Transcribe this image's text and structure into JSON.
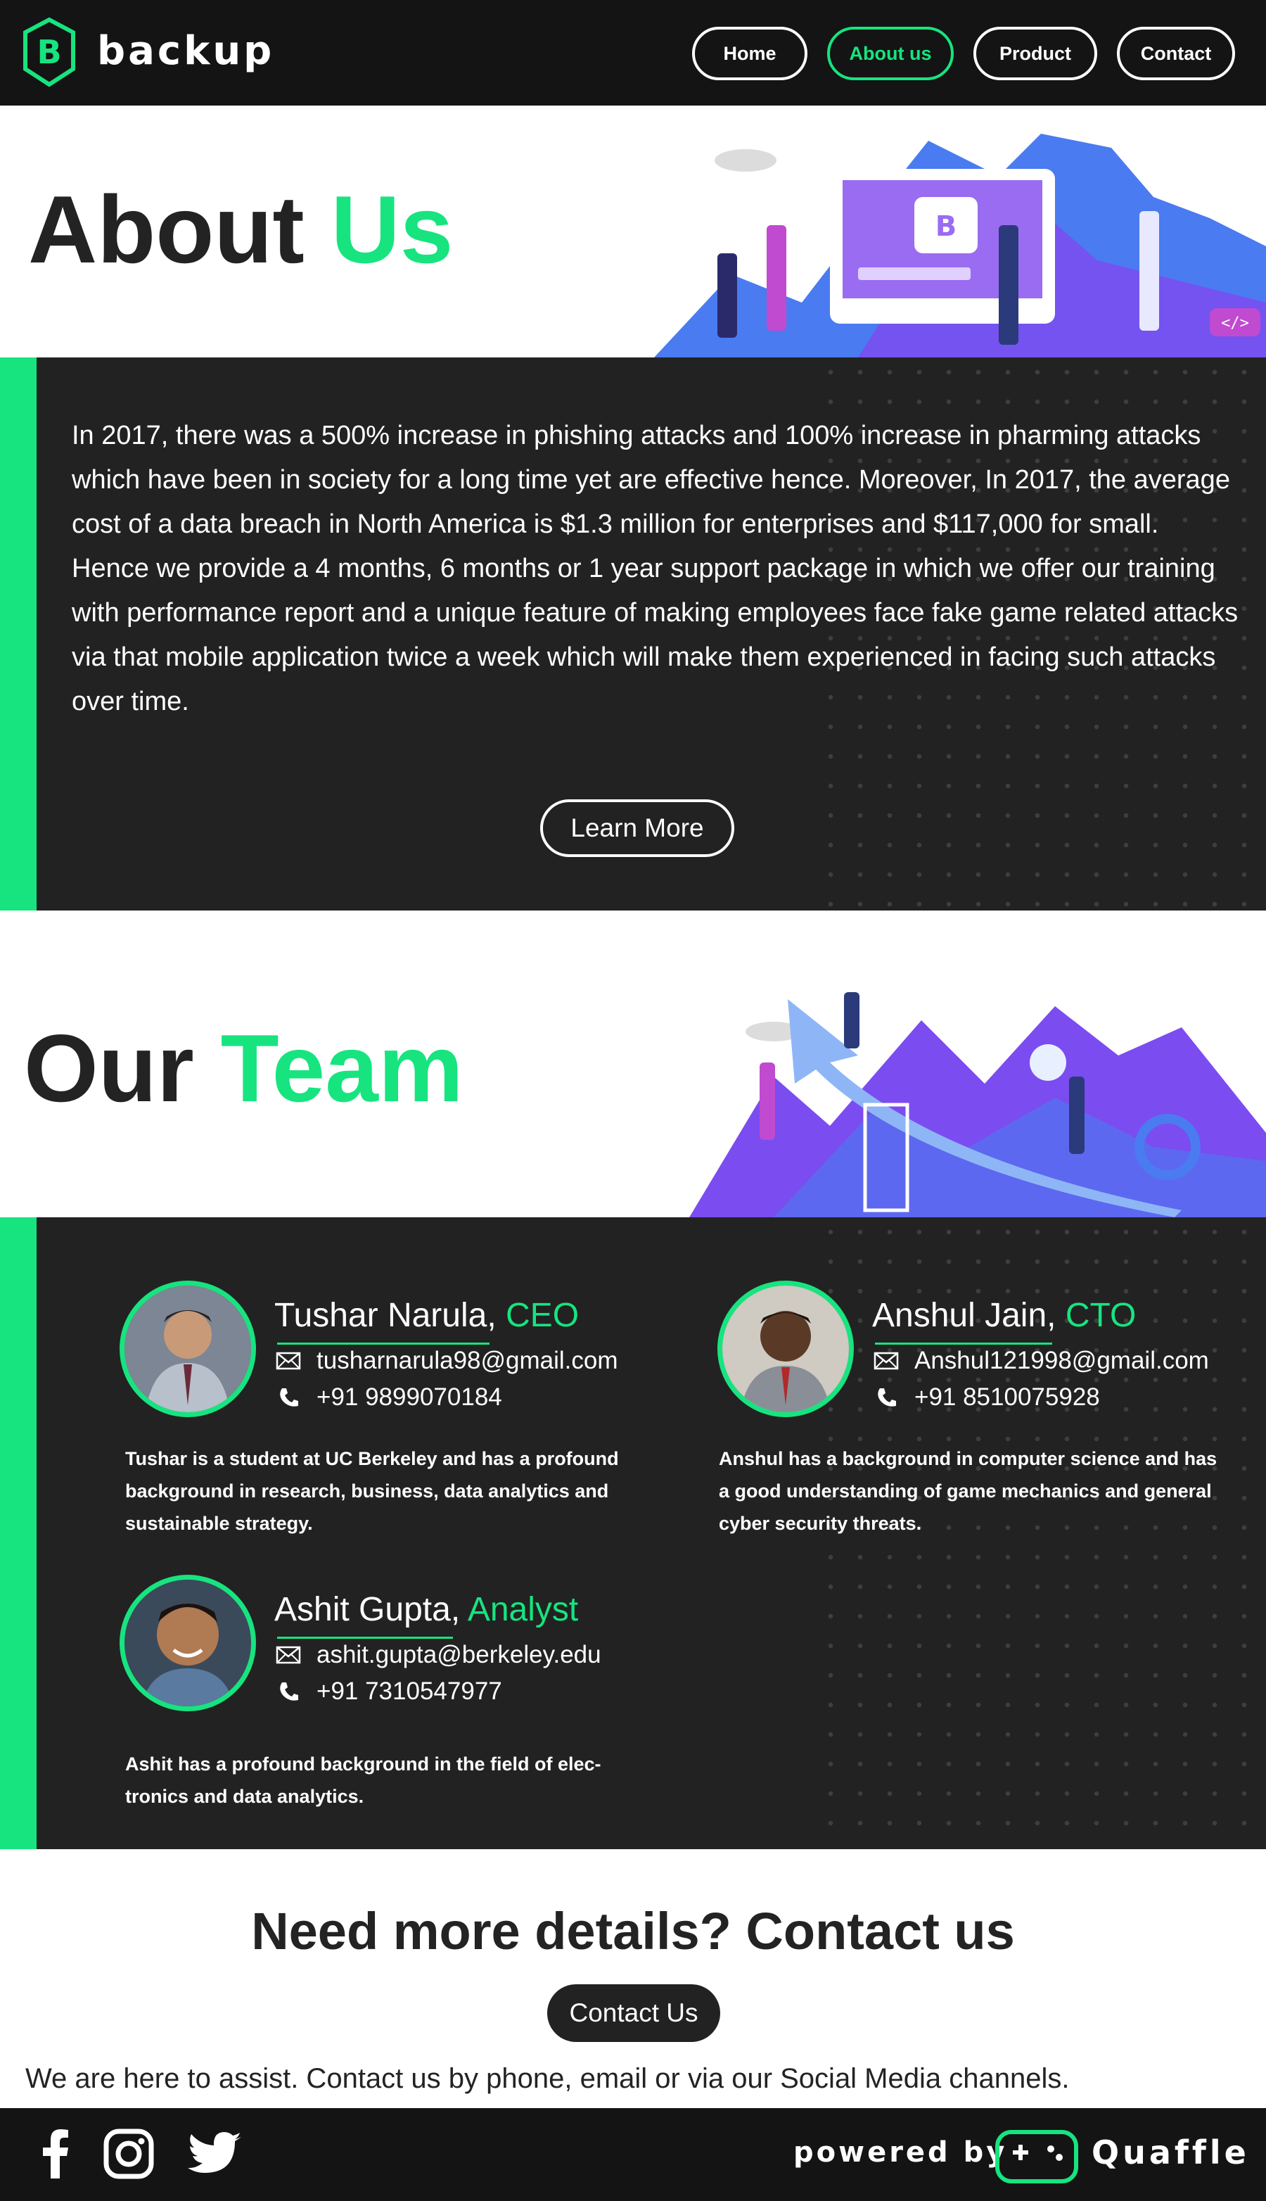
{
  "header": {
    "brand": "backup",
    "nav": [
      {
        "label": "Home"
      },
      {
        "label": "About us"
      },
      {
        "label": "Product"
      },
      {
        "label": "Contact"
      }
    ]
  },
  "about": {
    "title_part1": "About",
    "title_part2": "Us",
    "paragraph1": "In 2017, there was a 500% increase in phishing attacks and 100% increase in pharming attacks which have been in society for a long time yet are effective hence. Moreover, In 2017, the average cost of a data breach in North America is $1.3 million for enterprises and $117,000 for small.",
    "paragraph2": "Hence we provide a 4 months, 6 months or 1 year support package in which we offer our training with performance report and a unique feature of making employees face fake game related attacks via that mobile application twice a week which will make them experienced in facing such attacks over time.",
    "learn_more": "Learn More"
  },
  "team": {
    "title_part1": "Our",
    "title_part2": "Team",
    "members": [
      {
        "name": "Tushar Narula",
        "comma": ", ",
        "role": "CEO",
        "email": "tusharnarula98@gmail.com",
        "phone": "+91 9899070184",
        "bio": "Tushar is a student at UC Berkeley and has a profound background in research, business, data analytics and sustainable strategy."
      },
      {
        "name": "Anshul Jain",
        "comma": ", ",
        "role": "CTO",
        "email": "Anshul121998@gmail.com",
        "phone": "+91 8510075928",
        "bio": "Anshul has a background in computer science and has a good understanding of game mechanics and general cyber security threats."
      },
      {
        "name": "Ashit Gupta",
        "comma": ", ",
        "role": "Analyst",
        "email": "ashit.gupta@berkeley.edu",
        "phone": "+91 7310547977",
        "bio": "Ashit has a profound background in the field of elec-tronics and data analytics."
      }
    ]
  },
  "contact": {
    "title": "Need more details? Contact us",
    "button": "Contact Us",
    "assist": "We are here to assist. Contact us by phone, email or via our Social Media channels."
  },
  "footer": {
    "social_icons": [
      "facebook-icon",
      "instagram-icon",
      "twitter-icon"
    ],
    "powered_by": "powered by",
    "partner": "Quaffle"
  },
  "colors": {
    "accent": "#17e47f",
    "dark": "#222222",
    "header": "#141414",
    "illustration_purple": "#7b4cf0"
  }
}
